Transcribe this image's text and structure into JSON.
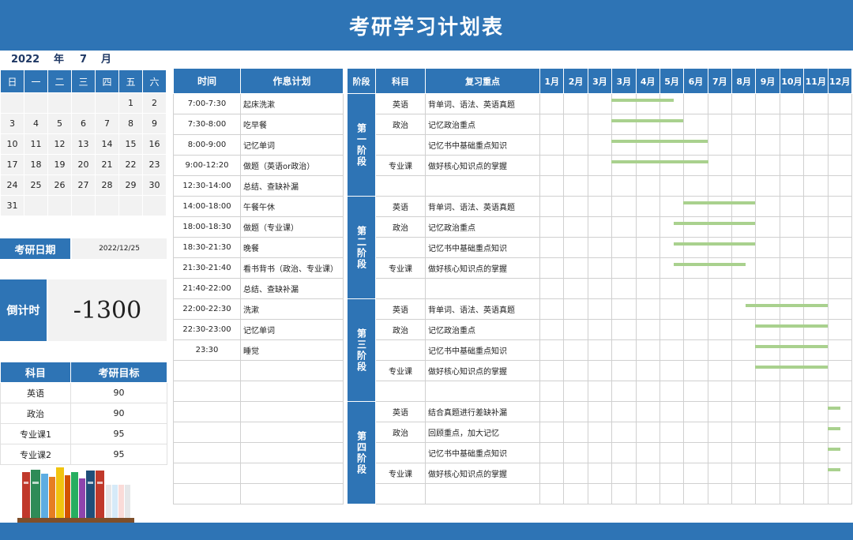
{
  "title": "考研学习计划表",
  "calendar": {
    "year": "2022",
    "year_unit": "年",
    "month": "7",
    "month_unit": "月",
    "weekdays": [
      "日",
      "一",
      "二",
      "三",
      "四",
      "五",
      "六"
    ],
    "weeks": [
      [
        "",
        "",
        "",
        "",
        "",
        "1",
        "2"
      ],
      [
        "3",
        "4",
        "5",
        "6",
        "7",
        "8",
        "9"
      ],
      [
        "10",
        "11",
        "12",
        "13",
        "14",
        "15",
        "16"
      ],
      [
        "17",
        "18",
        "19",
        "20",
        "21",
        "22",
        "23"
      ],
      [
        "24",
        "25",
        "26",
        "27",
        "28",
        "29",
        "30"
      ],
      [
        "31",
        "",
        "",
        "",
        "",
        "",
        ""
      ]
    ]
  },
  "exam_date": {
    "label": "考研日期",
    "value": "2022/12/25"
  },
  "countdown": {
    "label": "倒计时",
    "value": "-1300"
  },
  "goals": {
    "headers": [
      "科目",
      "考研目标"
    ],
    "rows": [
      [
        "英语",
        "90"
      ],
      [
        "政治",
        "90"
      ],
      [
        "专业课1",
        "95"
      ],
      [
        "专业课2",
        "95"
      ]
    ]
  },
  "schedule": {
    "headers": [
      "时间",
      "作息计划"
    ],
    "rows": [
      [
        "7:00-7:30",
        "起床洗漱"
      ],
      [
        "7:30-8:00",
        "吃早餐"
      ],
      [
        "8:00-9:00",
        "记忆单词"
      ],
      [
        "9:00-12:20",
        "做题（英语or政治）"
      ],
      [
        "12:30-14:00",
        "总结、查缺补漏"
      ],
      [
        "14:00-18:00",
        "午餐午休"
      ],
      [
        "18:00-18:30",
        "做题（专业课）"
      ],
      [
        "18:30-21:30",
        "晚餐"
      ],
      [
        "21:30-21:40",
        "看书背书（政治、专业课）"
      ],
      [
        "21:40-22:00",
        "总结、查缺补漏"
      ],
      [
        "22:00-22:30",
        "洗漱"
      ],
      [
        "22:30-23:00",
        "记忆单词"
      ],
      [
        "23:30",
        "睡觉"
      ],
      [
        "",
        ""
      ],
      [
        "",
        ""
      ],
      [
        "",
        ""
      ],
      [
        "",
        ""
      ],
      [
        "",
        ""
      ],
      [
        "",
        ""
      ],
      [
        "",
        ""
      ]
    ]
  },
  "plan": {
    "headers": [
      "阶段",
      "科目",
      "复习重点"
    ],
    "months": [
      "1月",
      "2月",
      "3月",
      "3月",
      "4月",
      "5月",
      "6月",
      "7月",
      "8月",
      "9月",
      "10月",
      "11月",
      "12月"
    ],
    "stages": [
      {
        "name": "第一阶段",
        "rows": [
          {
            "subject": "英语",
            "focus": "背单词、语法、英语真题",
            "start": 3,
            "end": 5.6
          },
          {
            "subject": "政治",
            "focus": "记忆政治重点",
            "start": 3,
            "end": 6.0
          },
          {
            "subject": "",
            "focus": "记忆书中基础重点知识",
            "start": 3,
            "end": 7.0
          },
          {
            "subject": "专业课",
            "focus": "做好核心知识点的掌握",
            "start": 3,
            "end": 7.05
          },
          {
            "subject": "",
            "focus": "",
            "start": null,
            "end": null
          }
        ]
      },
      {
        "name": "第二阶段",
        "rows": [
          {
            "subject": "英语",
            "focus": "背单词、语法、英语真题",
            "start": 6.0,
            "end": 9.0
          },
          {
            "subject": "政治",
            "focus": "记忆政治重点",
            "start": 5.6,
            "end": 9.0
          },
          {
            "subject": "",
            "focus": "记忆书中基础重点知识",
            "start": 5.6,
            "end": 9.0
          },
          {
            "subject": "专业课",
            "focus": "做好核心知识点的掌握",
            "start": 5.6,
            "end": 8.6
          },
          {
            "subject": "",
            "focus": "",
            "start": null,
            "end": null
          }
        ]
      },
      {
        "name": "第三阶段",
        "rows": [
          {
            "subject": "英语",
            "focus": "背单词、语法、英语真题",
            "start": 8.6,
            "end": 12.0
          },
          {
            "subject": "政治",
            "focus": "记忆政治重点",
            "start": 9.0,
            "end": 12.0
          },
          {
            "subject": "",
            "focus": "记忆书中基础重点知识",
            "start": 9.0,
            "end": 12.0
          },
          {
            "subject": "专业课",
            "focus": "做好核心知识点的掌握",
            "start": 9.0,
            "end": 12.0
          },
          {
            "subject": "",
            "focus": "",
            "start": null,
            "end": null
          }
        ]
      },
      {
        "name": "第四阶段",
        "rows": [
          {
            "subject": "英语",
            "focus": "结合真题进行差缺补漏",
            "start": 12.0,
            "end": 12.55
          },
          {
            "subject": "政治",
            "focus": "回顾重点，加大记忆",
            "start": 12.0,
            "end": 12.55
          },
          {
            "subject": "",
            "focus": "记忆书中基础重点知识",
            "start": 12.0,
            "end": 12.55
          },
          {
            "subject": "专业课",
            "focus": "做好核心知识点的掌握",
            "start": 12.0,
            "end": 12.55
          },
          {
            "subject": "",
            "focus": "",
            "start": null,
            "end": null
          }
        ]
      }
    ]
  },
  "colors": {
    "primary": "#2e74b5",
    "bar": "#a9d18e",
    "cell_bg": "#f2f2f2"
  },
  "icons": {
    "books": "books-illustration"
  }
}
